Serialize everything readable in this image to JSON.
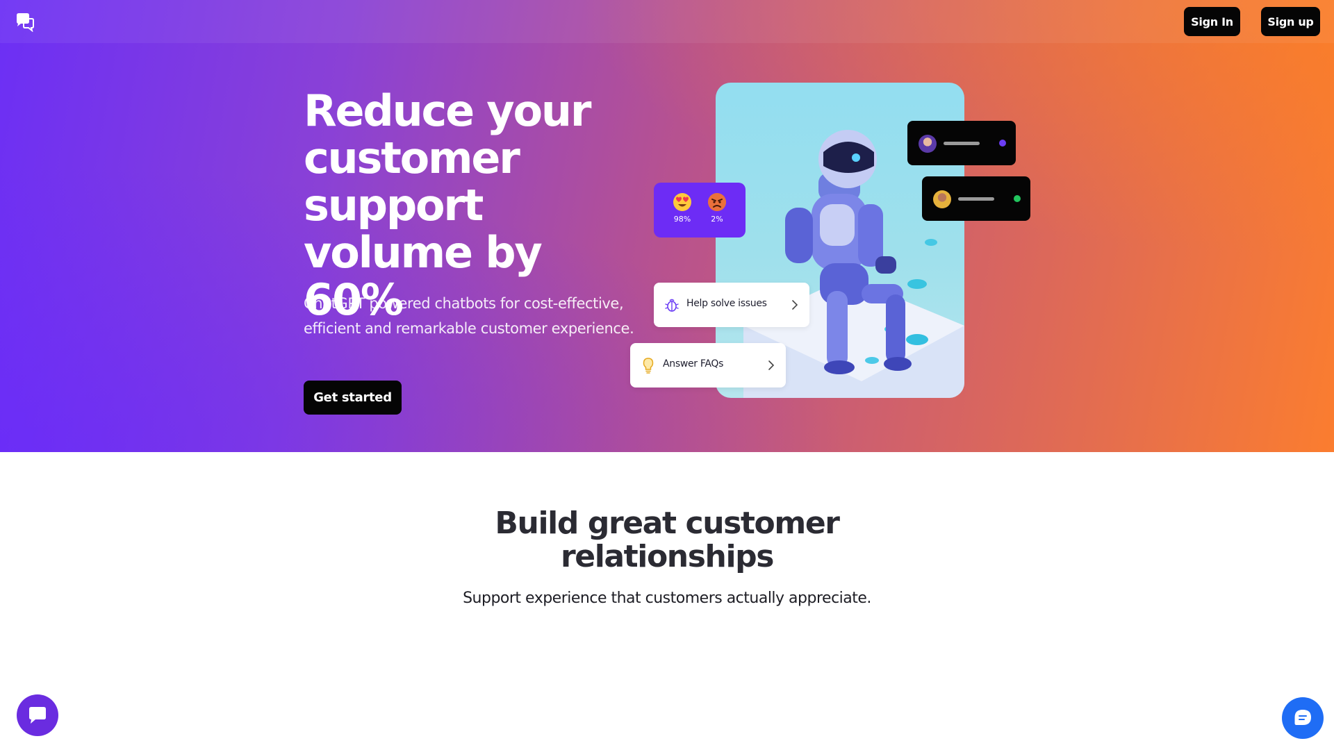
{
  "header": {
    "logo_icon": "chat-bubbles-icon",
    "sign_in_label": "Sign In",
    "sign_up_label": "Sign up"
  },
  "hero": {
    "headline": "Reduce your customer support volume by 60%",
    "subheadline": "ChatGPT powered chatbots for cost-effective, efficient and remarkable customer experience.",
    "cta_label": "Get started",
    "gradient_colors": [
      "#6c2ff5",
      "#b7528f",
      "#fb7d2f"
    ]
  },
  "illustration": {
    "sentiment": [
      {
        "emoji": "heart-eyes-icon",
        "value": "98%"
      },
      {
        "emoji": "angry-face-icon",
        "value": "2%"
      }
    ],
    "help_card_label": "Help solve issues",
    "help_card_icon": "bug-icon",
    "faq_card_label": "Answer FAQs",
    "faq_card_icon": "lightbulb-icon",
    "user_cards": [
      {
        "status_color": "#6b3df5"
      },
      {
        "status_color": "#22c55e"
      }
    ]
  },
  "section": {
    "title": "Build great customer relationships",
    "subtitle": "Support experience that customers actually appreciate."
  },
  "widgets": {
    "left_launcher_icon": "chat-bubble-icon",
    "right_launcher_icon": "message-icon"
  }
}
